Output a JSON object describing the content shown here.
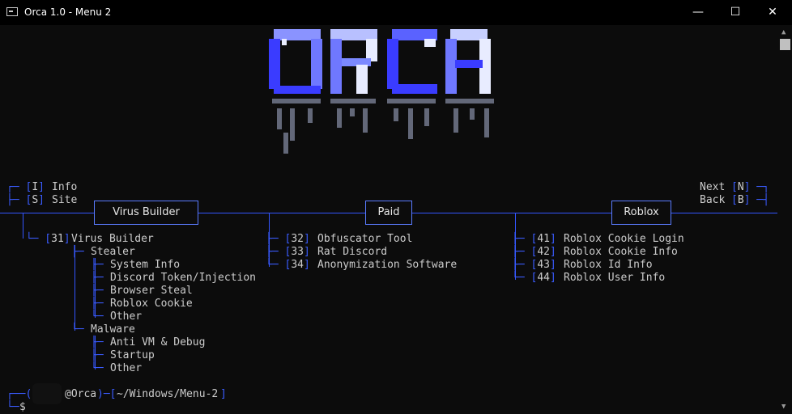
{
  "window": {
    "title": "Orca 1.0 - Menu 2",
    "minimize": "—",
    "maximize": "☐",
    "close": "✕"
  },
  "logo": {
    "text": "ORCA",
    "colors": {
      "bright": "#e8ecff",
      "mid": "#7b89ff",
      "deep": "#3a3cff",
      "shade": "#8890a8"
    }
  },
  "left_menu": {
    "info_key": "I",
    "info_label": "Info",
    "site_key": "S",
    "site_label": "Site"
  },
  "right_menu": {
    "next_label": "Next",
    "next_key": "N",
    "back_label": "Back",
    "back_key": "B"
  },
  "sections": [
    {
      "title": "Virus Builder"
    },
    {
      "title": "Paid"
    },
    {
      "title": "Roblox"
    }
  ],
  "virus_builder": {
    "item": {
      "num": "31",
      "label": "Virus Builder"
    },
    "stealer_label": "Stealer",
    "stealer": [
      "System Info",
      "Discord Token/Injection",
      "Browser Steal",
      "Roblox Cookie",
      "Other"
    ],
    "malware_label": "Malware",
    "malware": [
      "Anti VM & Debug",
      "Startup",
      "Other"
    ]
  },
  "paid_items": [
    {
      "num": "32",
      "label": "Obfuscator Tool"
    },
    {
      "num": "33",
      "label": "Rat Discord"
    },
    {
      "num": "34",
      "label": "Anonymization Software"
    }
  ],
  "roblox_items": [
    {
      "num": "41",
      "label": "Roblox Cookie Login"
    },
    {
      "num": "42",
      "label": "Roblox Cookie Info"
    },
    {
      "num": "43",
      "label": "Roblox Id Info"
    },
    {
      "num": "44",
      "label": "Roblox User Info"
    }
  ],
  "prompt": {
    "host": "@Orca",
    "path": "~/Windows/Menu-2",
    "symbol": "$"
  }
}
